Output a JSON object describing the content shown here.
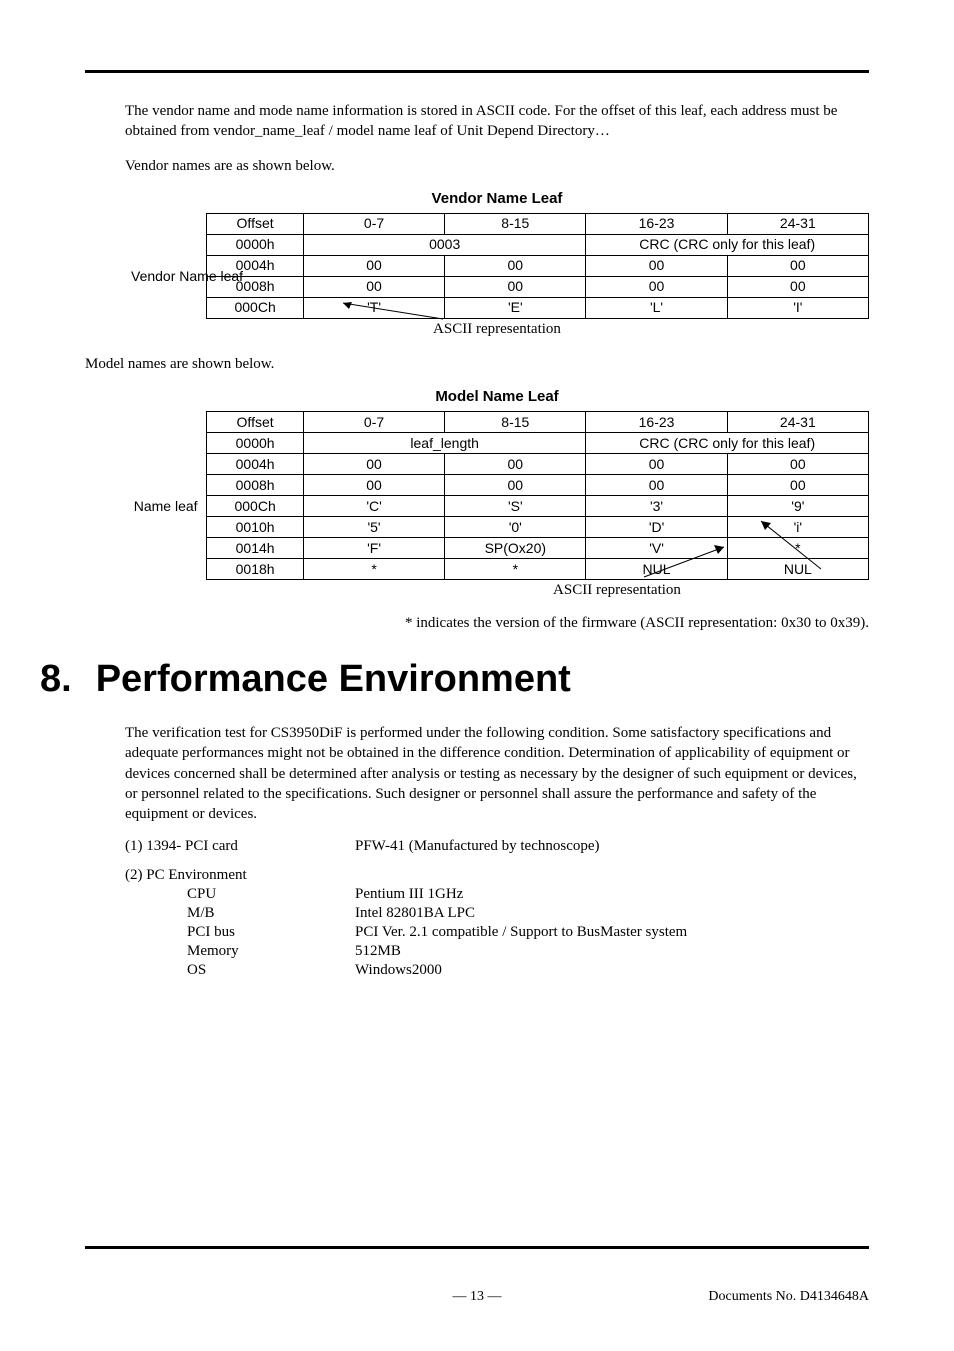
{
  "intro": {
    "p1": "The vendor name and mode name information is stored in ASCII code. For the offset of this leaf, each address must be obtained from vendor_name_leaf / model name leaf of Unit Depend Directory…",
    "p2": "Vendor names are as shown below.",
    "p3": "Model names are shown below."
  },
  "vendor_table": {
    "title": "Vendor Name Leaf",
    "side_label": "Vendor Name leaf",
    "header": [
      "Offset",
      "0-7",
      "8-15",
      "16-23",
      "24-31"
    ],
    "rows": [
      {
        "offset": "0000h",
        "c01": "0003",
        "c23": "CRC (CRC only for this leaf)"
      },
      {
        "offset": "0004h",
        "cells": [
          "00",
          "00",
          "00",
          "00"
        ]
      },
      {
        "offset": "0008h",
        "cells": [
          "00",
          "00",
          "00",
          "00"
        ]
      },
      {
        "offset": "000Ch",
        "cells": [
          "'T'",
          "'E'",
          "'L'",
          "'I'"
        ]
      }
    ],
    "caption": "ASCII representation"
  },
  "model_table": {
    "title": "Model Name Leaf",
    "side_label": "Name leaf",
    "header": [
      "Offset",
      "0-7",
      "8-15",
      "16-23",
      "24-31"
    ],
    "rows": [
      {
        "offset": "0000h",
        "c01": "leaf_length",
        "c23": "CRC (CRC only for this leaf)"
      },
      {
        "offset": "0004h",
        "cells": [
          "00",
          "00",
          "00",
          "00"
        ]
      },
      {
        "offset": "0008h",
        "cells": [
          "00",
          "00",
          "00",
          "00"
        ]
      },
      {
        "offset": "000Ch",
        "cells": [
          "'C'",
          "'S'",
          "'3'",
          "'9'"
        ]
      },
      {
        "offset": "0010h",
        "cells": [
          "'5'",
          "'0'",
          "'D'",
          "'i'"
        ]
      },
      {
        "offset": "0014h",
        "cells": [
          "'F'",
          "SP(Ox20)",
          "'V'",
          "*"
        ]
      },
      {
        "offset": "0018h",
        "cells": [
          "*",
          "*",
          "NUL",
          "NUL"
        ]
      }
    ],
    "caption": "ASCII representation",
    "footnote": "* indicates the version of the firmware (ASCII representation: 0x30 to 0x39)."
  },
  "section8": {
    "num": "8.",
    "title": "Performance Environment",
    "para": "The verification test for CS3950DiF is performed under the following condition. Some satisfactory specifications and adequate performances might not be obtained in the difference condition. Determination of applicability of equipment or devices concerned shall be determined after analysis or testing as necessary by the designer of such equipment or devices, or personnel related to the specifications. Such designer or personnel shall assure the performance and safety of the equipment or devices.",
    "items": {
      "i1_label": "(1) 1394- PCI card",
      "i1_val": "PFW-41 (Manufactured by technoscope)",
      "i2_label": "(2) PC Environment",
      "cpu_l": "CPU",
      "cpu_v": "Pentium III 1GHz",
      "mb_l": "M/B",
      "mb_v": "Intel 82801BA LPC",
      "pci_l": "PCI bus",
      "pci_v": "PCI Ver. 2.1 compatible / Support to BusMaster system",
      "mem_l": "Memory",
      "mem_v": "512MB",
      "os_l": "OS",
      "os_v": "Windows2000"
    }
  },
  "footer": {
    "page": "— 13 —",
    "doc": "Documents No. D4134648A"
  }
}
